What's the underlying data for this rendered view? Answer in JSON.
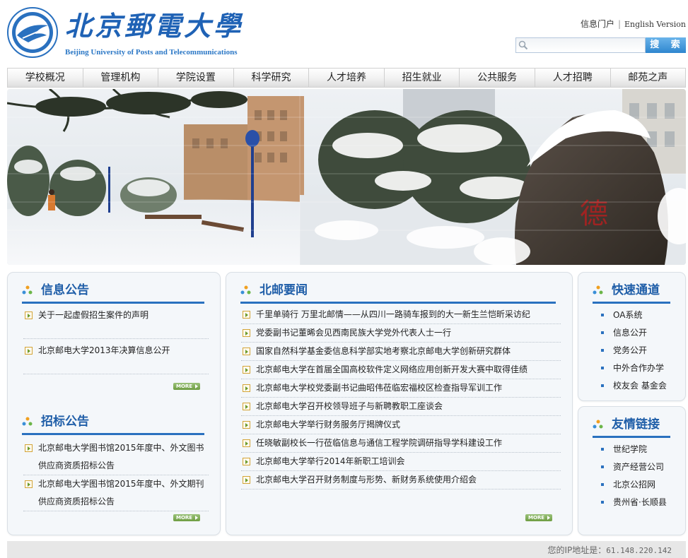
{
  "header": {
    "logo_cn": "北京郵電大學",
    "logo_en": "Beijing University of Posts and Telecommunications",
    "portal_link": "信息门户",
    "english_link": "English Version",
    "search_placeholder": "",
    "search_button": "搜 索"
  },
  "nav": {
    "items": [
      "学校概况",
      "管理机构",
      "学院设置",
      "科学研究",
      "人才培养",
      "招生就业",
      "公共服务",
      "人才招聘",
      "邮苑之声"
    ]
  },
  "notices": {
    "title": "信息公告",
    "items": [
      "关于一起虚假招生案件的声明",
      "北京邮电大学2013年决算信息公开"
    ],
    "more": "MORE"
  },
  "tenders": {
    "title": "招标公告",
    "items": [
      "北京邮电大学图书馆2015年度中、外文图书供应商资质招标公告",
      "北京邮电大学图书馆2015年度中、外文期刊供应商资质招标公告"
    ],
    "more": "MORE"
  },
  "news": {
    "title": "北邮要闻",
    "items": [
      "千里单骑行 万里北邮情——从四川一路骑车报到的大一新生兰恺昕采访纪",
      "党委副书记董晞会见西南民族大学党外代表人士一行",
      "国家自然科学基金委信息科学部实地考察北京邮电大学创新研究群体",
      "北京邮电大学在首届全国高校软件定义网络应用创新开发大赛中取得佳绩",
      "北京邮电大学校党委副书记曲昭伟莅临宏福校区检查指导军训工作",
      "北京邮电大学召开校领导班子与新聘教职工座谈会",
      "北京邮电大学举行财务服务厅揭牌仪式",
      "任晓敏副校长一行莅临信息与通信工程学院调研指导学科建设工作",
      "北京邮电大学举行2014年新职工培训会",
      "北京邮电大学召开财务制度与形势、新财务系统使用介绍会"
    ],
    "more": "MORE"
  },
  "quick": {
    "title": "快速通道",
    "items": [
      "OA系统",
      "信息公开",
      "党务公开",
      "中外合作办学",
      "校友会 基金会"
    ]
  },
  "links": {
    "title": "友情链接",
    "items": [
      "世纪学院",
      "资产经营公司",
      "北京公招网",
      "贵州省·长顺县"
    ]
  },
  "footer": {
    "ip_label": "您的IP地址是：",
    "ip_value": "61.148.220.142"
  },
  "colors": {
    "brand_blue": "#1f62b5",
    "heading_blue": "#1f5ea8",
    "underline_blue": "#2a71bf",
    "more_green": "#6e9d42"
  }
}
